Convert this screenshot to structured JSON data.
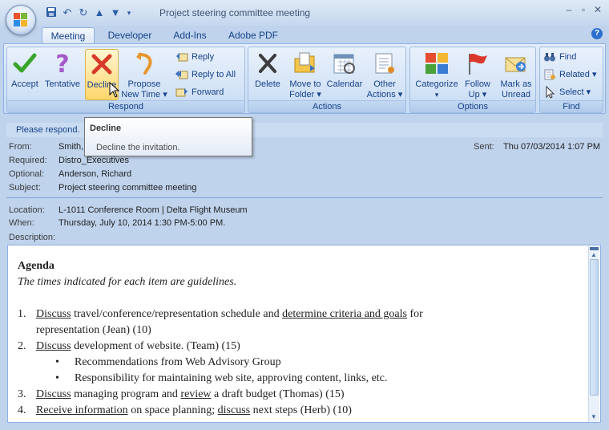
{
  "window": {
    "title": "Project steering committee meeting"
  },
  "tabs": [
    "Meeting",
    "Developer",
    "Add-Ins",
    "Adobe PDF"
  ],
  "ribbon": {
    "respond": {
      "label": "Respond",
      "accept": "Accept",
      "tentative": "Tentative",
      "decline": "Decline",
      "propose_line1": "Propose",
      "propose_line2": "New Time ▾",
      "reply": "Reply",
      "reply_all": "Reply to All",
      "forward": "Forward"
    },
    "actions": {
      "label": "Actions",
      "delete": "Delete",
      "move_line1": "Move to",
      "move_line2": "Folder ▾",
      "calendar": "Calendar",
      "other_line1": "Other",
      "other_line2": "Actions ▾"
    },
    "options": {
      "label": "Options",
      "categorize": "Categorize",
      "followup_line1": "Follow",
      "followup_line2": "Up ▾",
      "mark_line1": "Mark as",
      "mark_line2": "Unread"
    },
    "find": {
      "label": "Find",
      "find": "Find",
      "related": "Related ▾",
      "select": "Select ▾"
    }
  },
  "tooltip": {
    "title": "Decline",
    "description": "Decline the invitation."
  },
  "infobar": "Please respond.",
  "header": {
    "from_label": "From:",
    "from_value": "Smith,",
    "required_label": "Required:",
    "required_value": "Distro_Executives",
    "optional_label": "Optional:",
    "optional_value": "Anderson, Richard",
    "subject_label": "Subject:",
    "subject_value": "Project steering committee meeting",
    "sent_label": "Sent:",
    "sent_value": "Thu 07/03/2014 1:07 PM",
    "location_label": "Location:",
    "location_value": "L-1011 Conference Room | Delta Flight Museum",
    "when_label": "When:",
    "when_value": "Thursday, July 10, 2014 1:30 PM-5:00 PM.",
    "description_label": "Description:"
  },
  "body": {
    "heading": "Agenda",
    "intro": "The times indicated  for each item are guidelines.",
    "items": [
      {
        "num": "1.",
        "parts": [
          "Discuss",
          " travel/conference/representation schedule and ",
          "determine criteria and goals",
          " for"
        ],
        "cont": "representation (Jean)  (10)"
      },
      {
        "num": "2.",
        "parts": [
          "Discuss",
          " development of website.  (Team) (15)"
        ],
        "subitems": [
          "Recommendations from Web Advisory Group",
          "Responsibility for maintaining web site, approving content, links, etc."
        ]
      },
      {
        "num": "3.",
        "parts": [
          "Discuss",
          "  managing program and ",
          "review",
          " a draft budget (Thomas)  (15)"
        ]
      },
      {
        "num": "4.",
        "parts": [
          "Receive information",
          " on space planning; ",
          "discuss",
          " next steps  (Herb) (10)"
        ]
      }
    ]
  }
}
